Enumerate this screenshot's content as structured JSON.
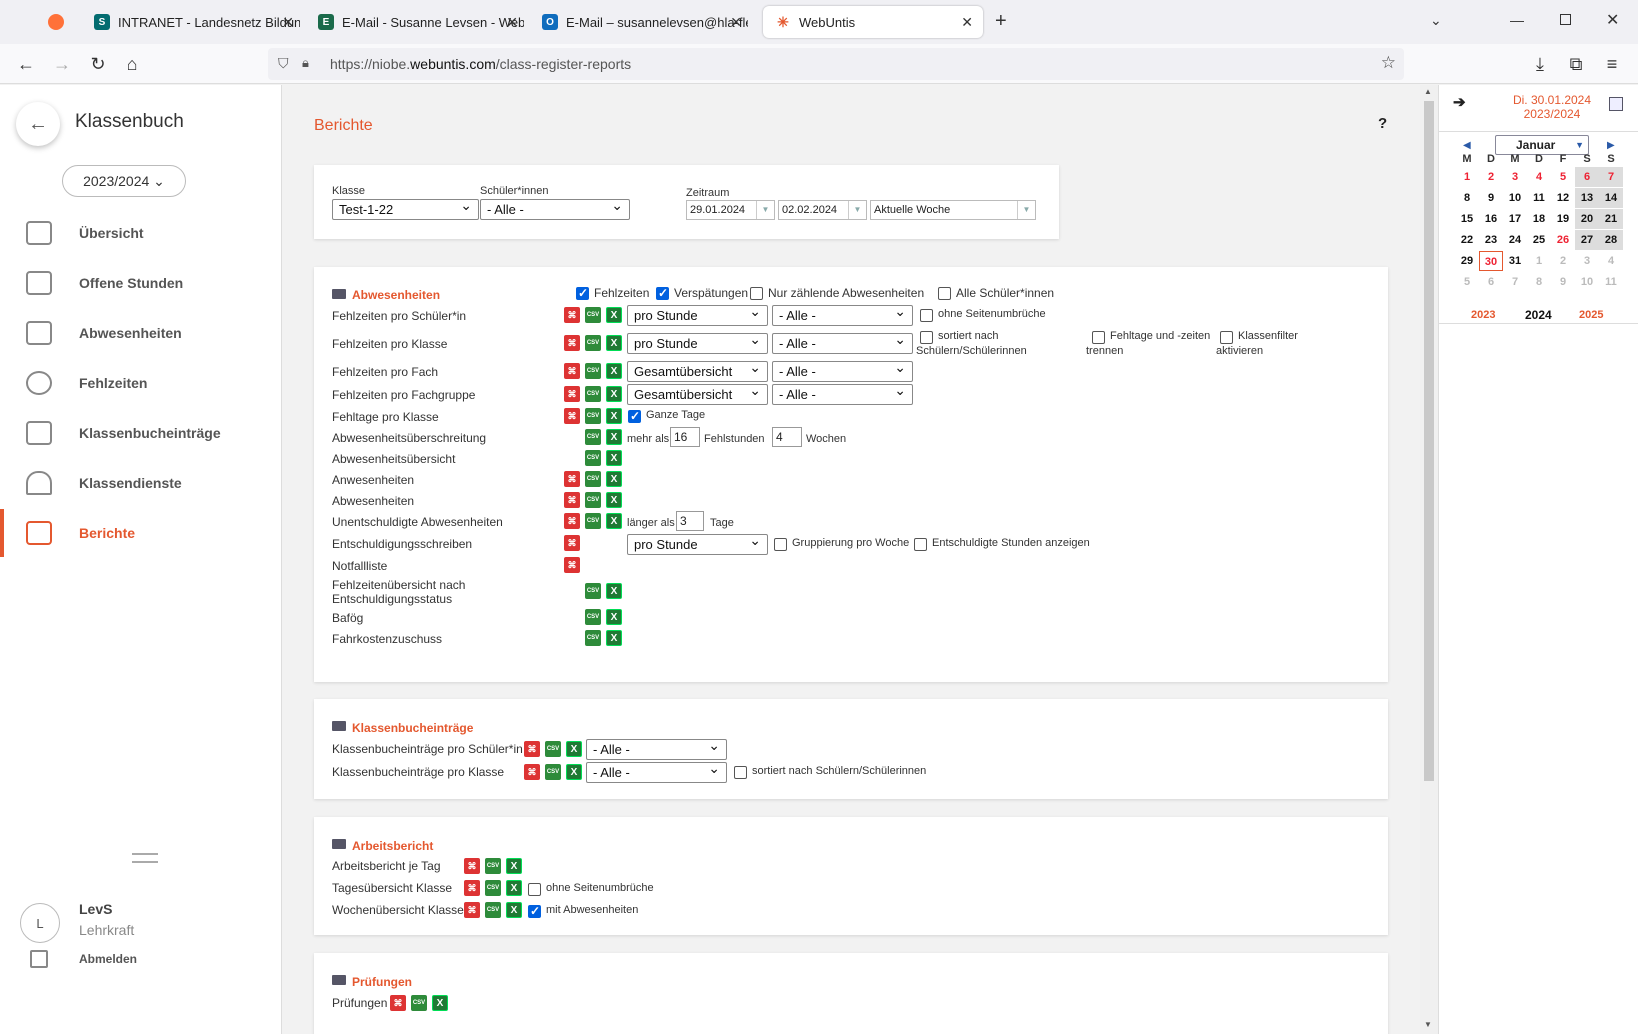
{
  "browser": {
    "tabs": [
      {
        "label": "",
        "icon": "firefox-icon"
      },
      {
        "label": "INTRANET - Landesnetz Bildung",
        "icon": "sharepoint-icon"
      },
      {
        "label": "E-Mail - Susanne Levsen - Webr",
        "icon": "exchange-icon"
      },
      {
        "label": "E-Mail – susannelevsen@hla-fle",
        "icon": "outlook-icon"
      },
      {
        "label": "WebUntis",
        "icon": "webuntis-icon"
      }
    ],
    "url_prefix": "https://niobe.",
    "url_domain": "webuntis.com",
    "url_path": "/class-register-reports"
  },
  "sidebar": {
    "title": "Klassenbuch",
    "year": "2023/2024",
    "items": [
      {
        "label": "Übersicht",
        "icon": "overview-icon"
      },
      {
        "label": "Offene Stunden",
        "icon": "briefcase-icon"
      },
      {
        "label": "Abwesenheiten",
        "icon": "chair-icon"
      },
      {
        "label": "Fehlzeiten",
        "icon": "clock-icon"
      },
      {
        "label": "Klassenbucheinträge",
        "icon": "entry-add-icon"
      },
      {
        "label": "Klassendienste",
        "icon": "person-icon"
      },
      {
        "label": "Berichte",
        "icon": "report-icon"
      }
    ],
    "user_initial": "L",
    "user_name": "LevS",
    "user_role": "Lehrkraft",
    "logout": "Abmelden"
  },
  "main": {
    "title": "Berichte",
    "help": "?",
    "filter": {
      "klasse_label": "Klasse",
      "klasse_value": "Test-1-22",
      "schueler_label": "Schüler*innen",
      "schueler_value": "- Alle -",
      "zeitraum_label": "Zeitraum",
      "date_from": "29.01.2024",
      "date_to": "02.02.2024",
      "range": "Aktuelle Woche"
    },
    "abwesenheiten": {
      "title": "Abwesenheiten",
      "cb_fehlzeiten": "Fehlzeiten",
      "cb_verspaetungen": "Verspätungen",
      "cb_nur_zaehlende": "Nur zählende Abwesenheiten",
      "cb_alle_schueler": "Alle Schüler*innen",
      "rows": [
        "Fehlzeiten pro Schüler*in",
        "Fehlzeiten pro Klasse",
        "Fehlzeiten pro Fach",
        "Fehlzeiten pro Fachgruppe",
        "Fehltage pro Klasse",
        "Abwesenheitsüberschreitung",
        "Abwesenheitsübersicht",
        "Anwesenheiten",
        "Abwesenheiten",
        "Unentschuldigte Abwesenheiten",
        "Entschuldigungsschreiben",
        "Notfallliste",
        "Fehlzeitenübersicht nach",
        "Entschuldigungsstatus",
        "Bafög",
        "Fahrkostenzuschuss"
      ],
      "pro_stunde": "pro Stunde",
      "alle": "- Alle -",
      "gesamtuebersicht": "Gesamtübersicht",
      "ohne_seitenumbrueche": "ohne Seitenumbrüche",
      "sortiert_nach": "sortiert nach",
      "schuelern": "Schülern/Schülerinnen",
      "fehltage_trennen_1": "Fehltage und -zeiten",
      "fehltage_trennen_2": "trennen",
      "klassenfilter_1": "Klassenfilter",
      "klassenfilter_2": "aktivieren",
      "ganze_tage": "Ganze Tage",
      "mehr_als": "mehr als",
      "fehlstunden_value": "16",
      "fehlstunden": "Fehlstunden",
      "wochen_value": "4",
      "wochen": "Wochen",
      "laenger_als": "länger als",
      "tage_value": "3",
      "tage": "Tage",
      "gruppierung": "Gruppierung pro Woche",
      "entschuldigte": "Entschuldigte Stunden anzeigen"
    },
    "klassenbuch": {
      "title": "Klassenbucheinträge",
      "row1": "Klassenbucheinträge pro Schüler*in",
      "row2": "Klassenbucheinträge pro Klasse",
      "alle": "- Alle -",
      "sortiert": "sortiert nach Schülern/Schülerinnen"
    },
    "arbeitsbericht": {
      "title": "Arbeitsbericht",
      "row1": "Arbeitsbericht je Tag",
      "row2": "Tagesübersicht Klasse",
      "row3": "Wochenübersicht Klasse",
      "ohne": "ohne Seitenumbrüche",
      "mit": "mit Abwesenheiten"
    },
    "pruefungen": {
      "title": "Prüfungen",
      "row1": "Prüfungen"
    }
  },
  "calendar": {
    "date": "Di. 30.01.2024",
    "schoolyear": "2023/2024",
    "month": "Januar",
    "weekdays": [
      "M",
      "D",
      "M",
      "D",
      "F",
      "S",
      "S"
    ],
    "weeks": [
      [
        "1",
        "2",
        "3",
        "4",
        "5",
        "6",
        "7"
      ],
      [
        "8",
        "9",
        "10",
        "11",
        "12",
        "13",
        "14"
      ],
      [
        "15",
        "16",
        "17",
        "18",
        "19",
        "20",
        "21"
      ],
      [
        "22",
        "23",
        "24",
        "25",
        "26",
        "27",
        "28"
      ],
      [
        "29",
        "30",
        "31",
        "1",
        "2",
        "3",
        "4"
      ],
      [
        "5",
        "6",
        "7",
        "8",
        "9",
        "10",
        "11"
      ]
    ],
    "years": [
      "2023",
      "2024",
      "2025"
    ],
    "accent": "#e4582f"
  }
}
